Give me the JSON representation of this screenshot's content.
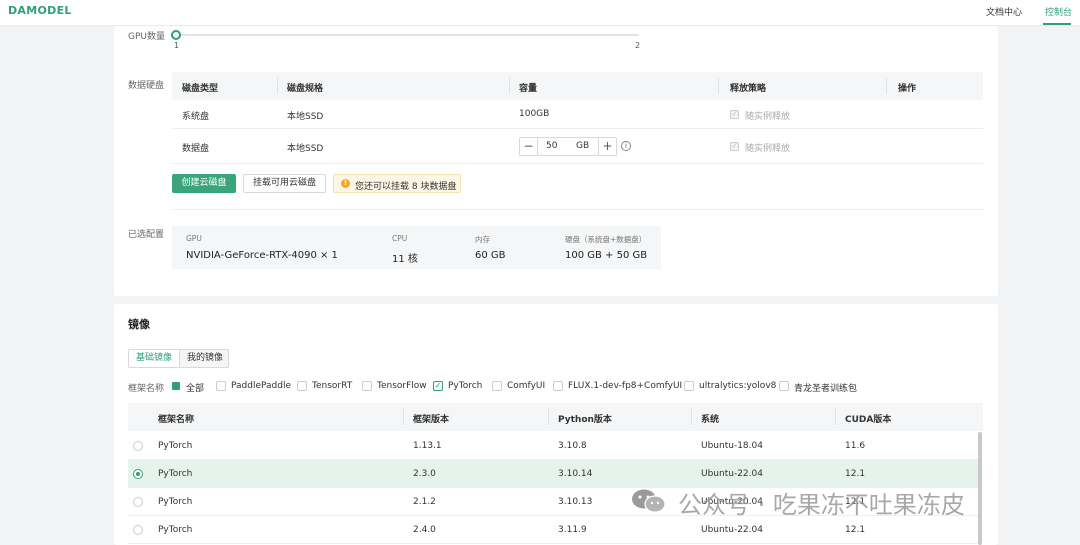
{
  "header": {
    "logo": "DAMODEL",
    "nav_docs": "文档中心",
    "nav_console": "控制台"
  },
  "gpu_count": {
    "label": "GPU数量",
    "min": "1",
    "max": "2",
    "selected": 1
  },
  "disk": {
    "label": "数据硬盘",
    "headers": [
      "磁盘类型",
      "磁盘规格",
      "容量",
      "释放策略",
      "操作"
    ],
    "system_row": {
      "type": "系统盘",
      "spec": "本地SSD",
      "capacity": "100GB",
      "policy": "随实例释放"
    },
    "data_row": {
      "type": "数据盘",
      "spec": "本地SSD",
      "capacity_value": "50",
      "capacity_unit": "GB",
      "policy": "随实例释放",
      "minus": "−",
      "plus": "+",
      "info": "i"
    },
    "create_button": "创建云磁盘",
    "mount_button": "挂载可用云磁盘",
    "notice": "您还可以挂载 8 块数据盘",
    "notice_icon": "!"
  },
  "selected_config": {
    "label": "已选配置",
    "gpu_label": "GPU",
    "gpu_value": "NVIDIA-GeForce-RTX-4090 × 1",
    "cpu_label": "CPU",
    "cpu_value": "11 核",
    "mem_label": "内存",
    "mem_value": "60 GB",
    "disk_label": "硬盘（系统盘+数据盘）",
    "disk_value": "100 GB + 50 GB"
  },
  "image": {
    "title": "镜像",
    "tab_basic": "基础镜像",
    "tab_mine": "我的镜像",
    "filter_label": "框架名称",
    "filters": [
      {
        "label": "全部",
        "checked": true
      },
      {
        "label": "PaddlePaddle",
        "checked": false
      },
      {
        "label": "TensorRT",
        "checked": false
      },
      {
        "label": "TensorFlow",
        "checked": false
      },
      {
        "label": "PyTorch",
        "checked": true
      },
      {
        "label": "ComfyUI",
        "checked": false
      },
      {
        "label": "FLUX.1-dev-fp8+ComfyUI",
        "checked": false
      },
      {
        "label": "ultralytics:yolov8",
        "checked": false
      },
      {
        "label": "青龙圣者训练包",
        "checked": false
      }
    ],
    "columns": [
      "框架名称",
      "框架版本",
      "Python版本",
      "系统",
      "CUDA版本"
    ],
    "rows": [
      {
        "framework": "PyTorch",
        "version": "1.13.1",
        "python": "3.10.8",
        "os": "Ubuntu-18.04",
        "cuda": "11.6",
        "selected": false
      },
      {
        "framework": "PyTorch",
        "version": "2.3.0",
        "python": "3.10.14",
        "os": "Ubuntu-22.04",
        "cuda": "12.1",
        "selected": true
      },
      {
        "framework": "PyTorch",
        "version": "2.1.2",
        "python": "3.10.13",
        "os": "Ubuntu-20.04",
        "cuda": "12.1",
        "selected": false
      },
      {
        "framework": "PyTorch",
        "version": "2.4.0",
        "python": "3.11.9",
        "os": "Ubuntu-22.04",
        "cuda": "12.1",
        "selected": false
      }
    ]
  },
  "watermark": "公众号 · 吃果冻不吐果冻皮",
  "colors": {
    "accent": "#2f9f74",
    "selected_row": "#e6f2ec",
    "warning": "#f0a825"
  }
}
